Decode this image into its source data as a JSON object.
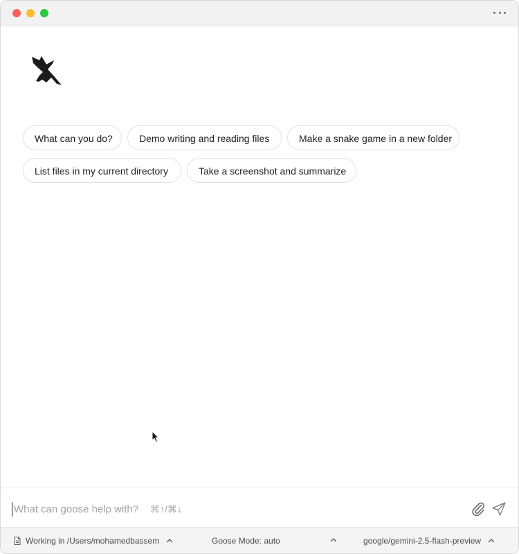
{
  "window": {
    "controls": [
      "close",
      "minimize",
      "maximize"
    ],
    "more_icon": "ellipsis-horizontal"
  },
  "branding": {
    "logo_icon": "goose-logo"
  },
  "suggestions": [
    {
      "label": "What can you do?"
    },
    {
      "label": "Demo writing and reading files"
    },
    {
      "label": "Make a snake game in a new folder"
    },
    {
      "label": "List files in my current directory"
    },
    {
      "label": "Take a screenshot and summarize"
    }
  ],
  "composer": {
    "placeholder": "What can goose help with?",
    "shortcut_hint": "⌘↑/⌘↓",
    "attach_icon": "paperclip",
    "send_icon": "send"
  },
  "status": {
    "working_dir": "Working in /Users/mohamedbassem",
    "mode": "Goose Mode: auto",
    "model": "google/gemini-2.5-flash-preview"
  }
}
